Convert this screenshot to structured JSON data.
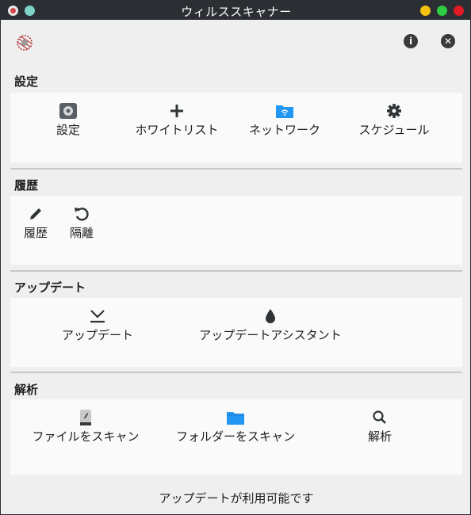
{
  "window": {
    "title": "ウィルススキャナー"
  },
  "sections": {
    "settings": {
      "title": "設定",
      "items": [
        {
          "label": "設定",
          "icon": "settings-app-icon"
        },
        {
          "label": "ホワイトリスト",
          "icon": "plus-icon"
        },
        {
          "label": "ネットワーク",
          "icon": "network-folder-icon"
        },
        {
          "label": "スケジュール",
          "icon": "gear-icon"
        }
      ]
    },
    "history": {
      "title": "履歴",
      "items": [
        {
          "label": "履歴",
          "icon": "pencil-icon"
        },
        {
          "label": "隔離",
          "icon": "undo-icon"
        }
      ]
    },
    "update": {
      "title": "アップデート",
      "items": [
        {
          "label": "アップデート",
          "icon": "download-icon"
        },
        {
          "label": "アップデートアシスタント",
          "icon": "drop-icon"
        }
      ]
    },
    "analysis": {
      "title": "解析",
      "items": [
        {
          "label": "ファイルをスキャン",
          "icon": "file-icon"
        },
        {
          "label": "フォルダーをスキャン",
          "icon": "folder-icon"
        },
        {
          "label": "解析",
          "icon": "search-icon"
        }
      ]
    }
  },
  "status": "アップデートが利用可能です",
  "colors": {
    "titlebar": "#2b2e33",
    "folder": "#2196f3",
    "panel": "#fafafa",
    "background": "#efefef"
  }
}
